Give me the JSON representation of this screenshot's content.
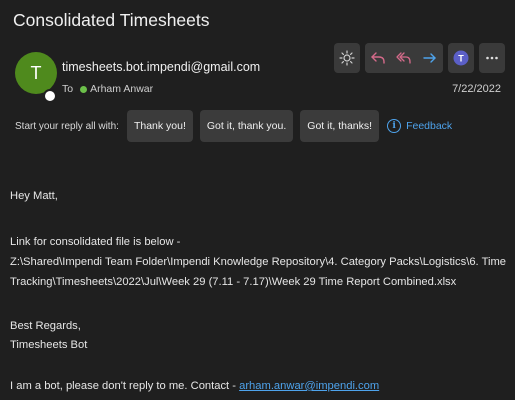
{
  "email": {
    "subject": "Consolidated Timesheets",
    "avatar_initial": "T",
    "sender": "timesheets.bot.impendi@gmail.com",
    "to_label": "To",
    "recipient": "Arham Anwar",
    "date": "7/22/2022"
  },
  "toolbar": {
    "buttons": [
      {
        "name": "sun-icon"
      },
      {
        "name": "reply-icon"
      },
      {
        "name": "reply-all-icon"
      },
      {
        "name": "forward-icon"
      },
      {
        "name": "teams-icon"
      },
      {
        "name": "more-icon"
      }
    ]
  },
  "quick_reply": {
    "label": "Start your reply all with:",
    "options": [
      "Thank you!",
      "Got it, thank you.",
      "Got it, thanks!"
    ],
    "feedback": "Feedback",
    "feedback_icon": "i"
  },
  "body": {
    "greeting": "Hey Matt,",
    "line1": "Link for consolidated file is below -",
    "line2": "Z:\\Shared\\Impendi Team Folder\\Impendi Knowledge Repository\\4. Category Packs\\Logistics\\6. Time",
    "line3": "Tracking\\Timesheets\\2022\\Jul\\Week 29 (7.11 - 7.17)\\Week 29 Time Report Combined.xlsx",
    "regards": "Best Regards,",
    "signature": "Timesheets Bot",
    "footer_text": "I am a bot, please don't reply to me. Contact - ",
    "footer_link": "arham.anwar@impendi.com"
  },
  "colors": {
    "background": "#1f1f1f",
    "accent": "#4ea3ec",
    "avatar": "#4f8a1d",
    "reply_arrows": "#d46a8a",
    "forward_arrow": "#4ea3ec",
    "teams": "#5b5fc7"
  }
}
